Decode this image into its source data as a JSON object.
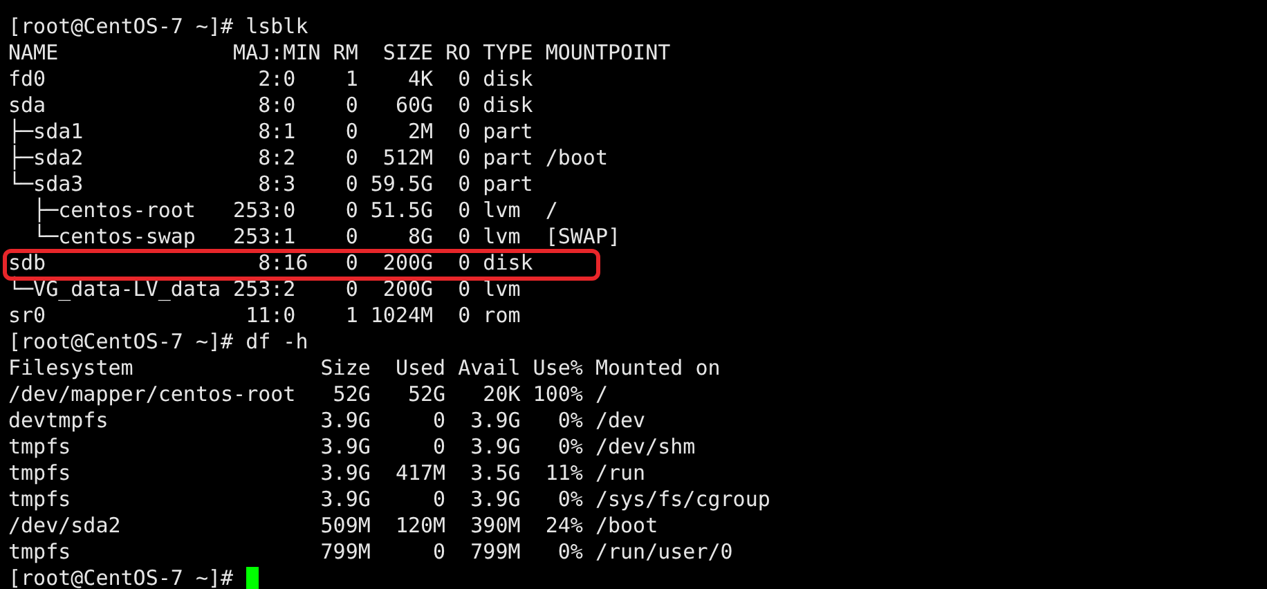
{
  "terminal": {
    "lines": [
      {
        "text": "[root@CentOS-7 ~]# lsblk",
        "highlighted": false
      },
      {
        "text": "NAME              MAJ:MIN RM  SIZE RO TYPE MOUNTPOINT",
        "highlighted": false
      },
      {
        "text": "fd0                 2:0    1    4K  0 disk",
        "highlighted": false
      },
      {
        "text": "sda                 8:0    0   60G  0 disk",
        "highlighted": false
      },
      {
        "text": "├─sda1              8:1    0    2M  0 part",
        "highlighted": false
      },
      {
        "text": "├─sda2              8:2    0  512M  0 part /boot",
        "highlighted": false
      },
      {
        "text": "└─sda3              8:3    0 59.5G  0 part",
        "highlighted": false
      },
      {
        "text": "  ├─centos-root   253:0    0 51.5G  0 lvm  /",
        "highlighted": false
      },
      {
        "text": "  └─centos-swap   253:1    0    8G  0 lvm  [SWAP]",
        "highlighted": false
      },
      {
        "text": "sdb                 8:16   0  200G  0 disk",
        "highlighted": true
      },
      {
        "text": "└─VG_data-LV_data 253:2    0  200G  0 lvm",
        "highlighted": false
      },
      {
        "text": "sr0                11:0    1 1024M  0 rom",
        "highlighted": false
      },
      {
        "text": "[root@CentOS-7 ~]# df -h",
        "highlighted": false
      },
      {
        "text": "Filesystem               Size  Used Avail Use% Mounted on",
        "highlighted": false
      },
      {
        "text": "/dev/mapper/centos-root   52G   52G   20K 100% /",
        "highlighted": false
      },
      {
        "text": "devtmpfs                 3.9G     0  3.9G   0% /dev",
        "highlighted": false
      },
      {
        "text": "tmpfs                    3.9G     0  3.9G   0% /dev/shm",
        "highlighted": false
      },
      {
        "text": "tmpfs                    3.9G  417M  3.5G  11% /run",
        "highlighted": false
      },
      {
        "text": "tmpfs                    3.9G     0  3.9G   0% /sys/fs/cgroup",
        "highlighted": false
      },
      {
        "text": "/dev/sda2                509M  120M  390M  24% /boot",
        "highlighted": false
      },
      {
        "text": "tmpfs                    799M     0  799M   0% /run/user/0",
        "highlighted": false
      }
    ],
    "input_line": {
      "prompt": "[root@CentOS-7 ~]#",
      "cursor": true
    }
  }
}
